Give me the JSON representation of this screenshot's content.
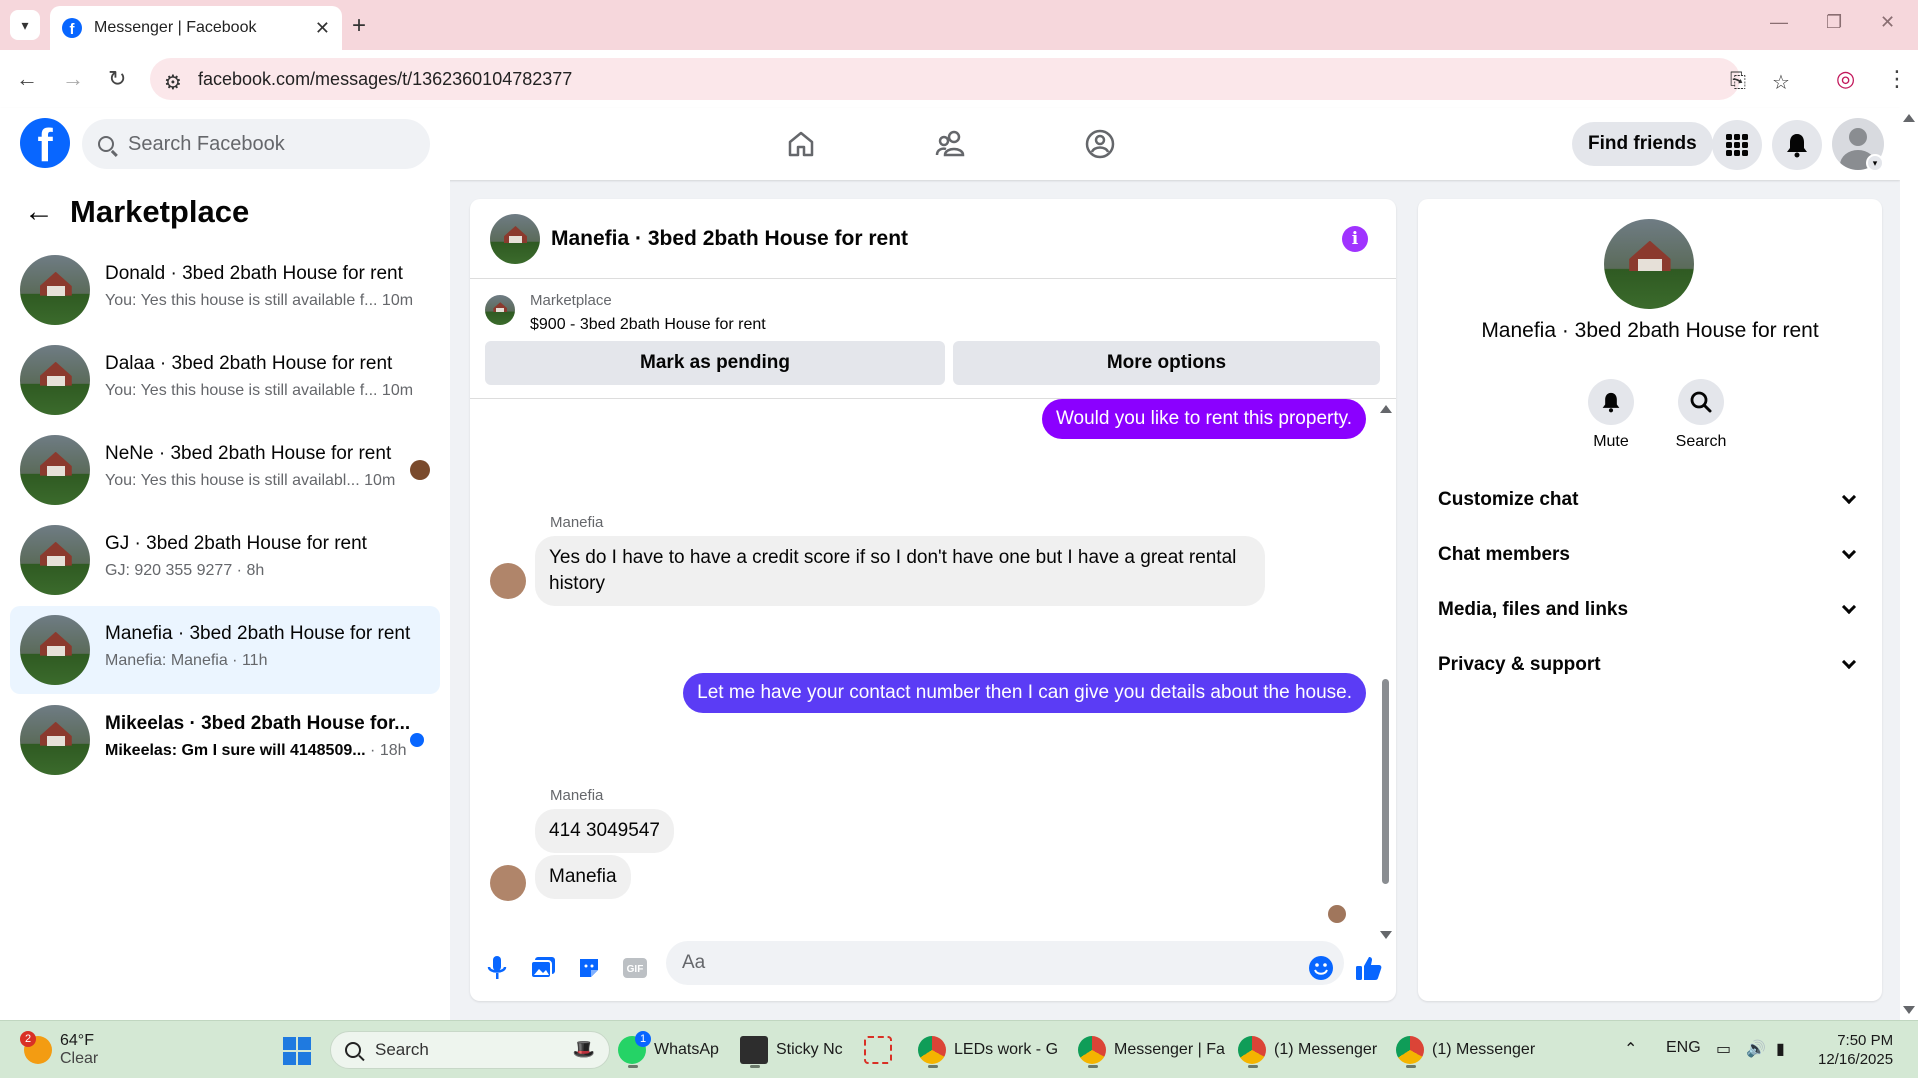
{
  "browser": {
    "tab_title": "Messenger | Facebook",
    "url": "facebook.com/messages/t/1362360104782377"
  },
  "fb_header": {
    "search_placeholder": "Search Facebook",
    "find_friends": "Find friends",
    "brand_color": "#0866ff"
  },
  "sidebar": {
    "title": "Marketplace",
    "conversations": [
      {
        "name": "Donald · 3bed 2bath House for rent",
        "snippet": "You: Yes this house is still available f...",
        "time": "10m"
      },
      {
        "name": "Dalaa · 3bed 2bath House for rent",
        "snippet": "You: Yes this house is still available f...",
        "time": "10m"
      },
      {
        "name": "NeNe · 3bed 2bath House for rent",
        "snippet": "You: Yes this house is still availabl...",
        "time": "10m"
      },
      {
        "name": "GJ · 3bed 2bath House for rent",
        "snippet": "GJ: 920 355 9277",
        "time": "8h"
      },
      {
        "name": "Manefia · 3bed 2bath House for rent",
        "snippet": "Manefia: Manefia",
        "time": "11h"
      },
      {
        "name": "Mikeelas · 3bed 2bath House for...",
        "snippet": "Mikeelas: Gm I sure will 4148509...",
        "time": "18h"
      }
    ]
  },
  "chat": {
    "title": "Manefia · 3bed 2bath House for rent",
    "marketplace_label": "Marketplace",
    "listing": "$900 - 3bed 2bath House for rent",
    "mark_pending": "Mark as pending",
    "more_options": "More options",
    "messages": {
      "m1": "Would you like to rent this property.",
      "sender1": "Manefia",
      "m2": "Yes do I have to have a credit score if so I don't have one but I have a great rental history",
      "m3": "Let me have your contact number then I can give you details about the house.",
      "sender2": "Manefia",
      "m4": "414 3049547",
      "m5": "Manefia"
    },
    "composer_placeholder": "Aa",
    "accent_purple": "#8b00ff"
  },
  "info_panel": {
    "name": "Manefia · 3bed 2bath House for rent",
    "mute": "Mute",
    "search": "Search",
    "rows": [
      "Customize chat",
      "Chat members",
      "Media, files and links",
      "Privacy & support"
    ]
  },
  "taskbar": {
    "weather_temp": "64°F",
    "weather_desc": "Clear",
    "weather_badge": "2",
    "search": "Search",
    "whatsapp": "WhatsAp",
    "whatsapp_badge": "1",
    "sticky": "Sticky Nc",
    "leds": "LEDs work - G",
    "messenger1": "Messenger | Fa",
    "messenger2": "(1) Messenger",
    "messenger3": "(1) Messenger",
    "lang": "ENG",
    "time": "7:50 PM",
    "date": "12/16/2025"
  }
}
